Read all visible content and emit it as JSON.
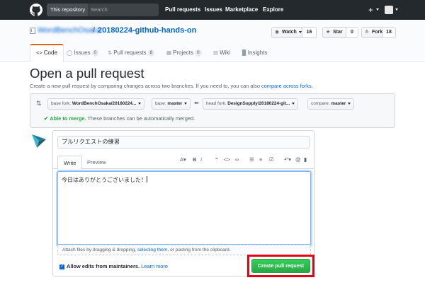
{
  "header": {
    "search_scope": "This repository",
    "search_placeholder": "Search",
    "nav": [
      "Pull requests",
      "Issues",
      "Marketplace",
      "Explore"
    ],
    "plus": "+"
  },
  "repo": {
    "owner": "WordBenchOsaka",
    "separator": "/",
    "name": "20180224-github-hands-on",
    "watch_label": "Watch",
    "watch_count": "16",
    "star_label": "Star",
    "star_count": "0",
    "fork_label": "Fork",
    "fork_count": "18",
    "tabs": [
      {
        "label": "Code",
        "counter": ""
      },
      {
        "label": "Issues",
        "counter": "0"
      },
      {
        "label": "Pull requests",
        "counter": "8"
      },
      {
        "label": "Projects",
        "counter": "0"
      },
      {
        "label": "Wiki",
        "counter": ""
      },
      {
        "label": "Insights",
        "counter": ""
      }
    ]
  },
  "page": {
    "title": "Open a pull request",
    "description": "Create a new pull request by comparing changes across two branches. If you need to, you can also ",
    "description_link": "compare across forks."
  },
  "range": {
    "base_fork_prefix": "base fork: ",
    "base_fork": "WordBenchOsaka/20180224...",
    "base_prefix": "base: ",
    "base": "master",
    "head_fork_prefix": "head fork: ",
    "head_fork": "DesignSupply/20180224-git...",
    "compare_prefix": "compare: ",
    "compare": "master",
    "merge_status": "Able to merge.",
    "merge_note": " These branches can be automatically merged."
  },
  "form": {
    "title_value": "プルリクエストの練習",
    "tab_write": "Write",
    "tab_preview": "Preview",
    "comment_value": "今日はありがとうございました！",
    "drag_text": "Attach files by dragging & dropping, ",
    "drag_link": "selecting them",
    "drag_text_end": ", or pasting from the clipboard.",
    "allow_label": "Allow edits from maintainers.",
    "learn_more": "Learn more",
    "submit_label": "Create pull request"
  },
  "colors": {
    "header_bg": "#24292e",
    "link": "#0366d6",
    "success": "#28a745",
    "highlight": "#e50012",
    "tab_accent": "#e36209"
  }
}
